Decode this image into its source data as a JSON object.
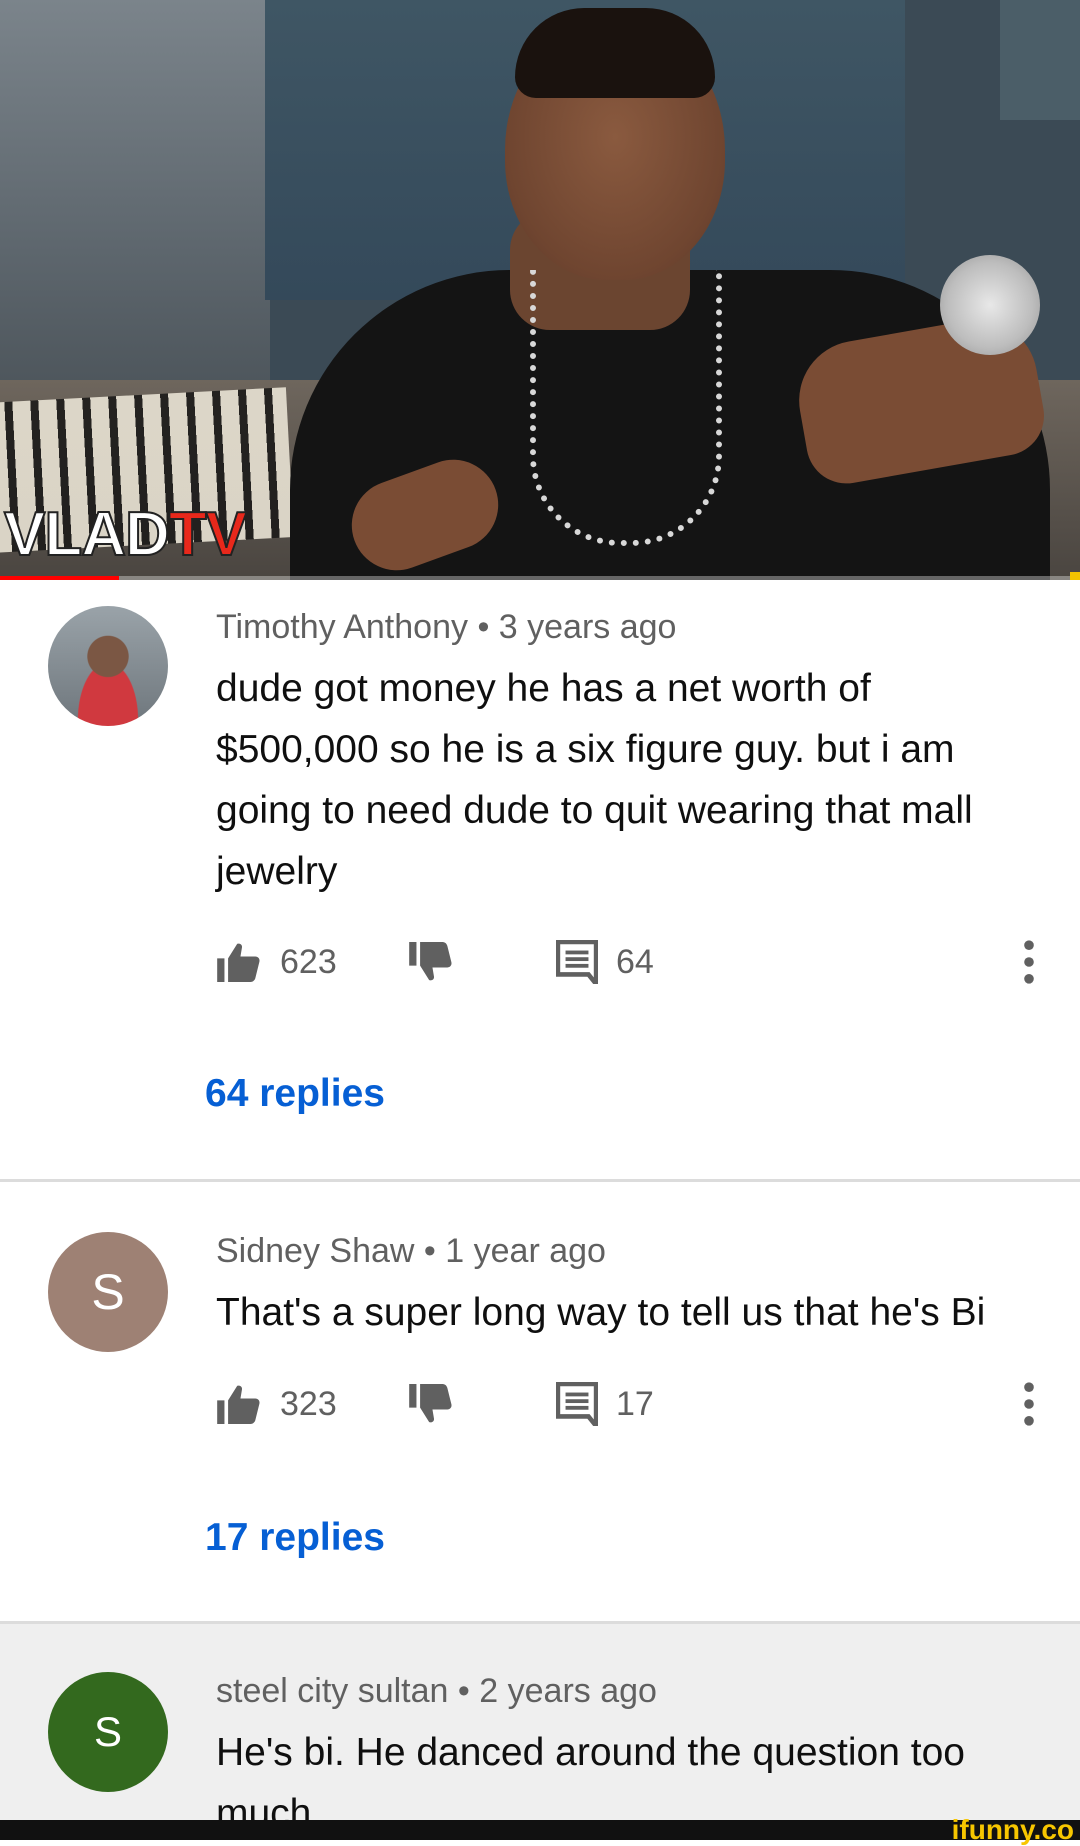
{
  "video": {
    "logo_main": "VLAD",
    "logo_accent": "TV",
    "progress": 0.11
  },
  "comments": [
    {
      "author": "Timothy Anthony",
      "separator": "•",
      "time": "3 years ago",
      "text_lines": [
        "dude got money he has a net worth of",
        "$500,000 so he is a six figure guy. but i am",
        "going to need dude to quit wearing that mall",
        "jewelry"
      ],
      "likes": "623",
      "reply_count": "64",
      "replies_link": "64 replies",
      "avatar": "photo"
    },
    {
      "author": "Sidney Shaw",
      "separator": "•",
      "time": "1 year ago",
      "text_lines": [
        "That's a super long way to tell us that he's Bi"
      ],
      "likes": "323",
      "reply_count": "17",
      "replies_link": "17 replies",
      "avatar_letter": "S",
      "avatar_color": "#9e8174"
    },
    {
      "author": "steel city sultan",
      "separator": "•",
      "time": "2 years ago",
      "text_lines": [
        "He's bi. He danced around the question too",
        "much"
      ],
      "avatar_letter": "S",
      "avatar_color": "#33691e"
    }
  ],
  "icons": {
    "like": "thumb-up-icon",
    "dislike": "thumb-down-icon",
    "reply": "comment-icon",
    "more": "more-vert-icon"
  },
  "colors": {
    "link": "#065fd4",
    "meta": "#606060",
    "progress": "#ff0000"
  },
  "watermark": "ifunny.co"
}
